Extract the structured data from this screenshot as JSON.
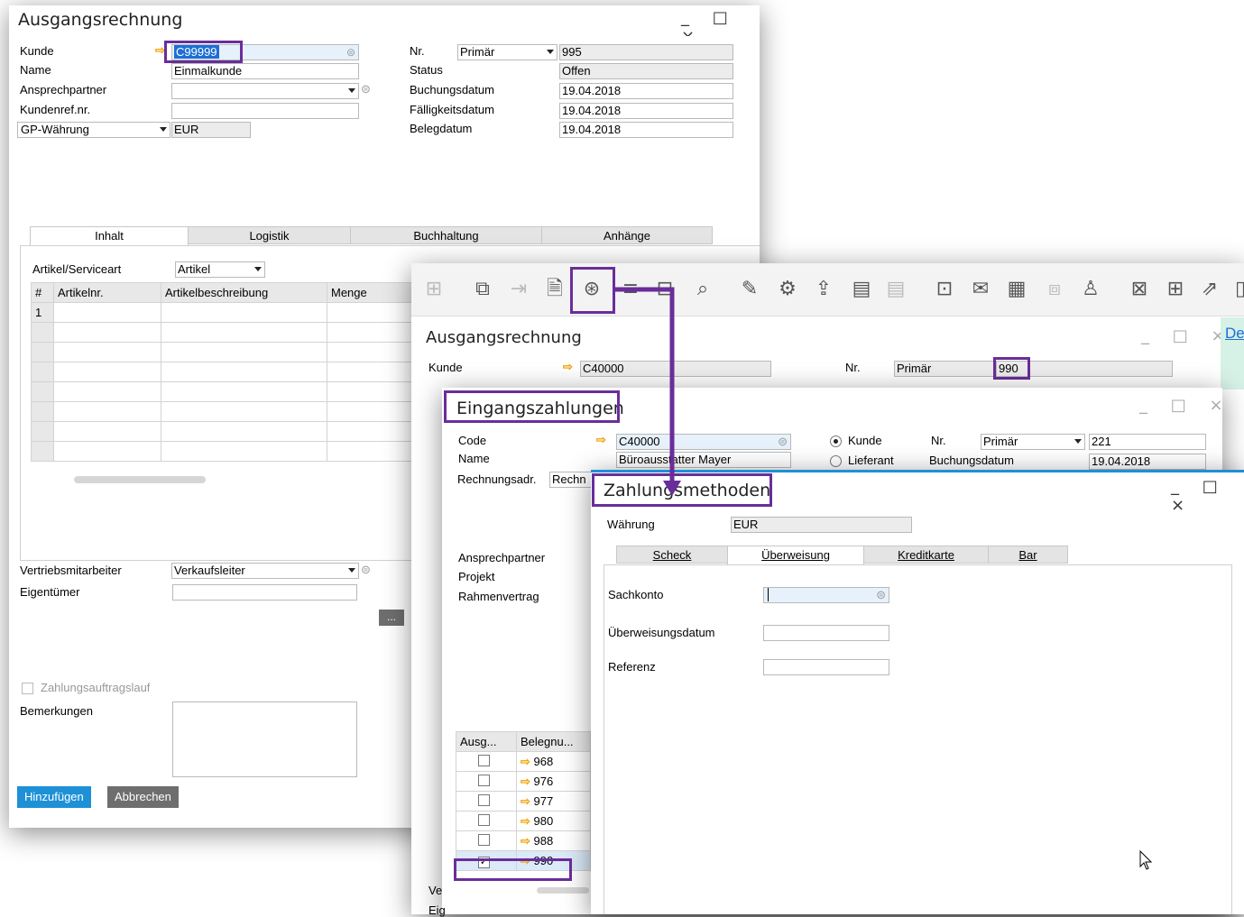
{
  "invoice1": {
    "title": "Ausgangsrechnung",
    "controls": "_ □ ×",
    "kunde_label": "Kunde",
    "kunde_value": "C99999",
    "name_label": "Name",
    "name_value": "Einmalkunde",
    "ansprech_label": "Ansprechpartner",
    "kundenref_label": "Kundenref.nr.",
    "gpw_label": "GP-Währung",
    "gpw_value": "EUR",
    "nr_label": "Nr.",
    "nr_series": "Primär",
    "nr_value": "995",
    "status_label": "Status",
    "status_value": "Offen",
    "buchung_label": "Buchungsdatum",
    "buchung_value": "19.04.2018",
    "faellig_label": "Fälligkeitsdatum",
    "faellig_value": "19.04.2018",
    "beleg_label": "Belegdatum",
    "beleg_value": "19.04.2018",
    "tabs": [
      "Inhalt",
      "Logistik",
      "Buchhaltung",
      "Anhänge"
    ],
    "artikel_label": "Artikel/Serviceart",
    "artikel_value": "Artikel",
    "grid_headers": [
      "#",
      "Artikelnr.",
      "Artikelbeschreibung",
      "Menge"
    ],
    "first_row": "1",
    "vertrieb_label": "Vertriebsmitarbeiter",
    "vertrieb_value": "Verkaufsleiter",
    "eigentuemer_label": "Eigentümer",
    "more_btn": "...",
    "zahlungslauf_label": "Zahlungsauftragslauf",
    "bemerkungen_label": "Bemerkungen",
    "add_btn": "Hinzufügen",
    "cancel_btn": "Abbrechen"
  },
  "invoice2": {
    "title": "Ausgangsrechnung",
    "controls": "_ □ ×",
    "kunde_label": "Kunde",
    "kunde_value": "C40000",
    "nr_label": "Nr.",
    "nr_series": "Primär",
    "nr_value": "990",
    "side_label": "De"
  },
  "payments": {
    "title": "Eingangszahlungen",
    "controls": "_ □ ×",
    "code_label": "Code",
    "code_value": "C40000",
    "name_label": "Name",
    "name_value": "Büroausstatter Mayer",
    "radio_kunde": "Kunde",
    "radio_lieferant": "Lieferant",
    "nr_label": "Nr.",
    "nr_series": "Primär",
    "nr_value": "221",
    "buchung_label": "Buchungsdatum",
    "buchung_value": "19.04.2018",
    "rechnungsadr_label": "Rechnungsadr.",
    "rechnungsadr_value": "Rechn",
    "ansprech_label": "Ansprechpartner",
    "projekt_label": "Projekt",
    "rahmen_label": "Rahmenvertrag",
    "list_headers": [
      "Ausg...",
      "Belegnu..."
    ],
    "rows": [
      {
        "num": "968",
        "checked": false
      },
      {
        "num": "976",
        "checked": false
      },
      {
        "num": "977",
        "checked": false
      },
      {
        "num": "980",
        "checked": false
      },
      {
        "num": "988",
        "checked": false
      },
      {
        "num": "990",
        "checked": true
      }
    ],
    "bottom_1": "Ve",
    "bottom_2": "Eig"
  },
  "methods": {
    "title": "Zahlungsmethoden",
    "controls": "_ □ ×",
    "waehrung_label": "Währung",
    "waehrung_value": "EUR",
    "tabs": [
      "Scheck",
      "Überweisung",
      "Kreditkarte",
      "Bar"
    ],
    "sachkonto_label": "Sachkonto",
    "datum_label": "Überweisungsdatum",
    "referenz_label": "Referenz"
  },
  "colors": {
    "highlight": "#6a2d9a",
    "accent": "#1e90d6",
    "arrow": "#f0a000"
  }
}
